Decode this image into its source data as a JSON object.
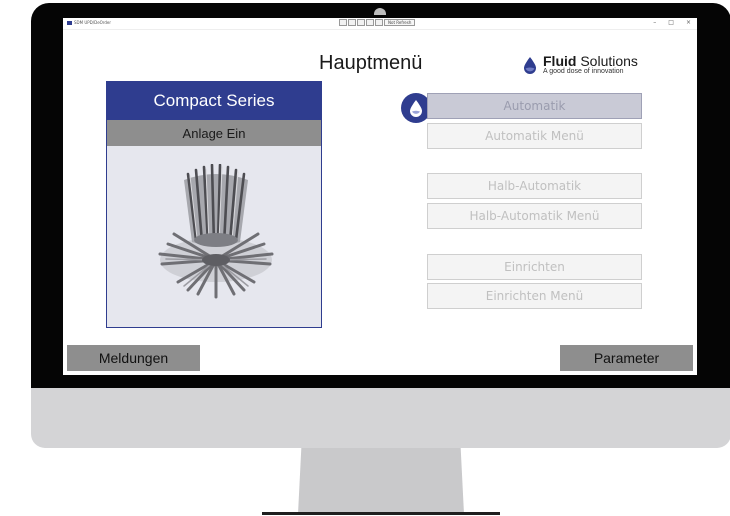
{
  "window": {
    "app_title": "SDM UPD/DeOrder",
    "status_text": "Not Refresh",
    "controls": [
      "–",
      "□",
      "×"
    ]
  },
  "header": {
    "title": "Hauptmenü",
    "brand_bold": "Fluid",
    "brand_regular": "Solutions",
    "brand_tagline": "A good dose of innovation"
  },
  "panel": {
    "series_title": "Compact Series",
    "status_label": "Anlage Ein"
  },
  "menu": {
    "automatik": "Automatik",
    "automatik_menu": "Automatik Menü",
    "halb_automatik": "Halb-Automatik",
    "halb_automatik_menu": "Halb-Automatik Menü",
    "einrichten": "Einrichten",
    "einrichten_menu": "Einrichten Menü"
  },
  "footer": {
    "meldungen": "Meldungen",
    "parameter": "Parameter"
  },
  "colors": {
    "accent": "#2f3d8f",
    "button_grey": "#8e8e8e",
    "disabled_text": "#c0c0c0"
  },
  "icons": {
    "brand": "water-drop-icon",
    "automatik": "drop-icon"
  }
}
